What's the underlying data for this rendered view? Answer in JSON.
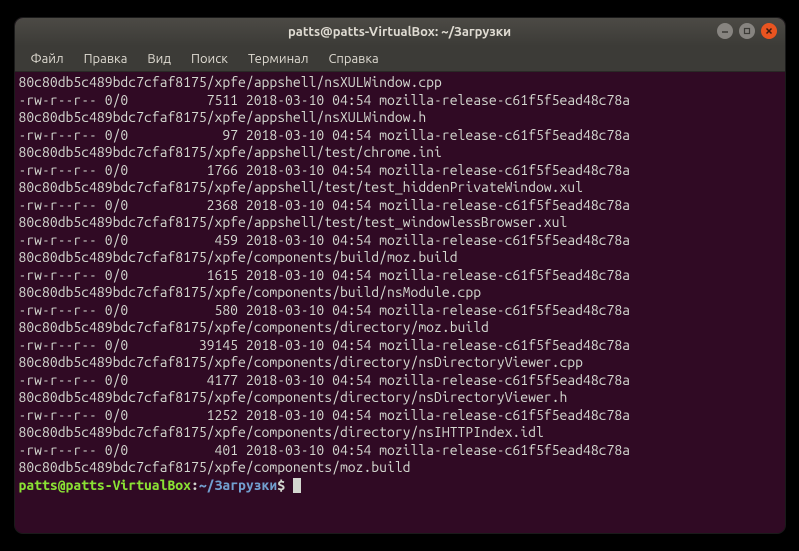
{
  "titlebar": {
    "title": "patts@patts-VirtualBox: ~/Загрузки"
  },
  "menu": {
    "file": "Файл",
    "edit": "Правка",
    "view": "Вид",
    "search": "Поиск",
    "terminal": "Терминал",
    "help": "Справка"
  },
  "prompt": {
    "userhost": "patts@patts-VirtualBox",
    "sep": ":",
    "path": "~/Загрузки",
    "symbol": "$"
  },
  "hash": "80c80db5c489bdc7cfaf8175",
  "entries": [
    {
      "cont": "/xpfe/appshell/nsXULWindow.cpp",
      "perms": "-rw-r--r--",
      "own": "0/0",
      "size": "7511",
      "date": "2018-03-10 04:54",
      "name": "mozilla-release-c61f5f5ead48c78a"
    },
    {
      "cont": "/xpfe/appshell/nsXULWindow.h",
      "perms": "-rw-r--r--",
      "own": "0/0",
      "size": "97",
      "date": "2018-03-10 04:54",
      "name": "mozilla-release-c61f5f5ead48c78a"
    },
    {
      "cont": "/xpfe/appshell/test/chrome.ini",
      "perms": "-rw-r--r--",
      "own": "0/0",
      "size": "1766",
      "date": "2018-03-10 04:54",
      "name": "mozilla-release-c61f5f5ead48c78a"
    },
    {
      "cont": "/xpfe/appshell/test/test_hiddenPrivateWindow.xul",
      "perms": "-rw-r--r--",
      "own": "0/0",
      "size": "2368",
      "date": "2018-03-10 04:54",
      "name": "mozilla-release-c61f5f5ead48c78a"
    },
    {
      "cont": "/xpfe/appshell/test/test_windowlessBrowser.xul",
      "perms": "-rw-r--r--",
      "own": "0/0",
      "size": "459",
      "date": "2018-03-10 04:54",
      "name": "mozilla-release-c61f5f5ead48c78a"
    },
    {
      "cont": "/xpfe/components/build/moz.build",
      "perms": "-rw-r--r--",
      "own": "0/0",
      "size": "1615",
      "date": "2018-03-10 04:54",
      "name": "mozilla-release-c61f5f5ead48c78a"
    },
    {
      "cont": "/xpfe/components/build/nsModule.cpp",
      "perms": "-rw-r--r--",
      "own": "0/0",
      "size": "580",
      "date": "2018-03-10 04:54",
      "name": "mozilla-release-c61f5f5ead48c78a"
    },
    {
      "cont": "/xpfe/components/directory/moz.build",
      "perms": "-rw-r--r--",
      "own": "0/0",
      "size": "39145",
      "date": "2018-03-10 04:54",
      "name": "mozilla-release-c61f5f5ead48c78a"
    },
    {
      "cont": "/xpfe/components/directory/nsDirectoryViewer.cpp",
      "perms": "-rw-r--r--",
      "own": "0/0",
      "size": "4177",
      "date": "2018-03-10 04:54",
      "name": "mozilla-release-c61f5f5ead48c78a"
    },
    {
      "cont": "/xpfe/components/directory/nsDirectoryViewer.h",
      "perms": "-rw-r--r--",
      "own": "0/0",
      "size": "1252",
      "date": "2018-03-10 04:54",
      "name": "mozilla-release-c61f5f5ead48c78a"
    },
    {
      "cont": "/xpfe/components/directory/nsIHTTPIndex.idl",
      "perms": "-rw-r--r--",
      "own": "0/0",
      "size": "401",
      "date": "2018-03-10 04:54",
      "name": "mozilla-release-c61f5f5ead48c78a"
    },
    {
      "cont": "/xpfe/components/moz.build"
    }
  ]
}
